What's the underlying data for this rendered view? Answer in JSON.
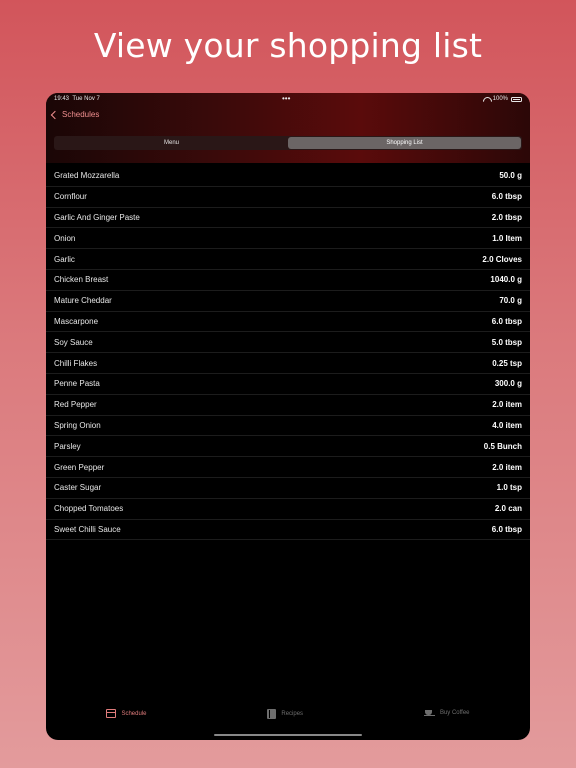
{
  "headline": "View your shopping list",
  "status_bar": {
    "time": "19:43",
    "date": "Tue Nov 7",
    "dots": "•••",
    "battery": "100%"
  },
  "nav": {
    "back_label": "Schedules"
  },
  "segments": [
    {
      "label": "Menu",
      "active": false
    },
    {
      "label": "Shopping List",
      "active": true
    }
  ],
  "shopping_list": [
    {
      "name": "Grated Mozzarella",
      "qty": "50.0 g"
    },
    {
      "name": "Cornflour",
      "qty": "6.0 tbsp"
    },
    {
      "name": "Garlic And Ginger Paste",
      "qty": "2.0 tbsp"
    },
    {
      "name": "Onion",
      "qty": "1.0 Item"
    },
    {
      "name": "Garlic",
      "qty": "2.0 Cloves"
    },
    {
      "name": "Chicken Breast",
      "qty": "1040.0 g"
    },
    {
      "name": "Mature Cheddar",
      "qty": "70.0 g"
    },
    {
      "name": "Mascarpone",
      "qty": "6.0 tbsp"
    },
    {
      "name": "Soy Sauce",
      "qty": "5.0 tbsp"
    },
    {
      "name": "Chilli Flakes",
      "qty": "0.25 tsp"
    },
    {
      "name": "Penne Pasta",
      "qty": "300.0 g"
    },
    {
      "name": "Red Pepper",
      "qty": "2.0 item"
    },
    {
      "name": "Spring Onion",
      "qty": "4.0 item"
    },
    {
      "name": "Parsley",
      "qty": "0.5 Bunch"
    },
    {
      "name": "Green Pepper",
      "qty": "2.0 item"
    },
    {
      "name": "Caster Sugar",
      "qty": "1.0 tsp"
    },
    {
      "name": "Chopped Tomatoes",
      "qty": "2.0 can"
    },
    {
      "name": "Sweet Chilli Sauce",
      "qty": "6.0 tbsp"
    }
  ],
  "tabs": [
    {
      "label": "Schedule",
      "icon": "calendar-icon",
      "active": true
    },
    {
      "label": "Recipes",
      "icon": "book-icon",
      "active": false
    },
    {
      "label": "Buy Coffee",
      "icon": "coffee-cup-icon",
      "active": false
    }
  ],
  "colors": {
    "accent": "#e07c7c",
    "background_top": "#d2555b",
    "background_bottom": "#e39b9c"
  }
}
